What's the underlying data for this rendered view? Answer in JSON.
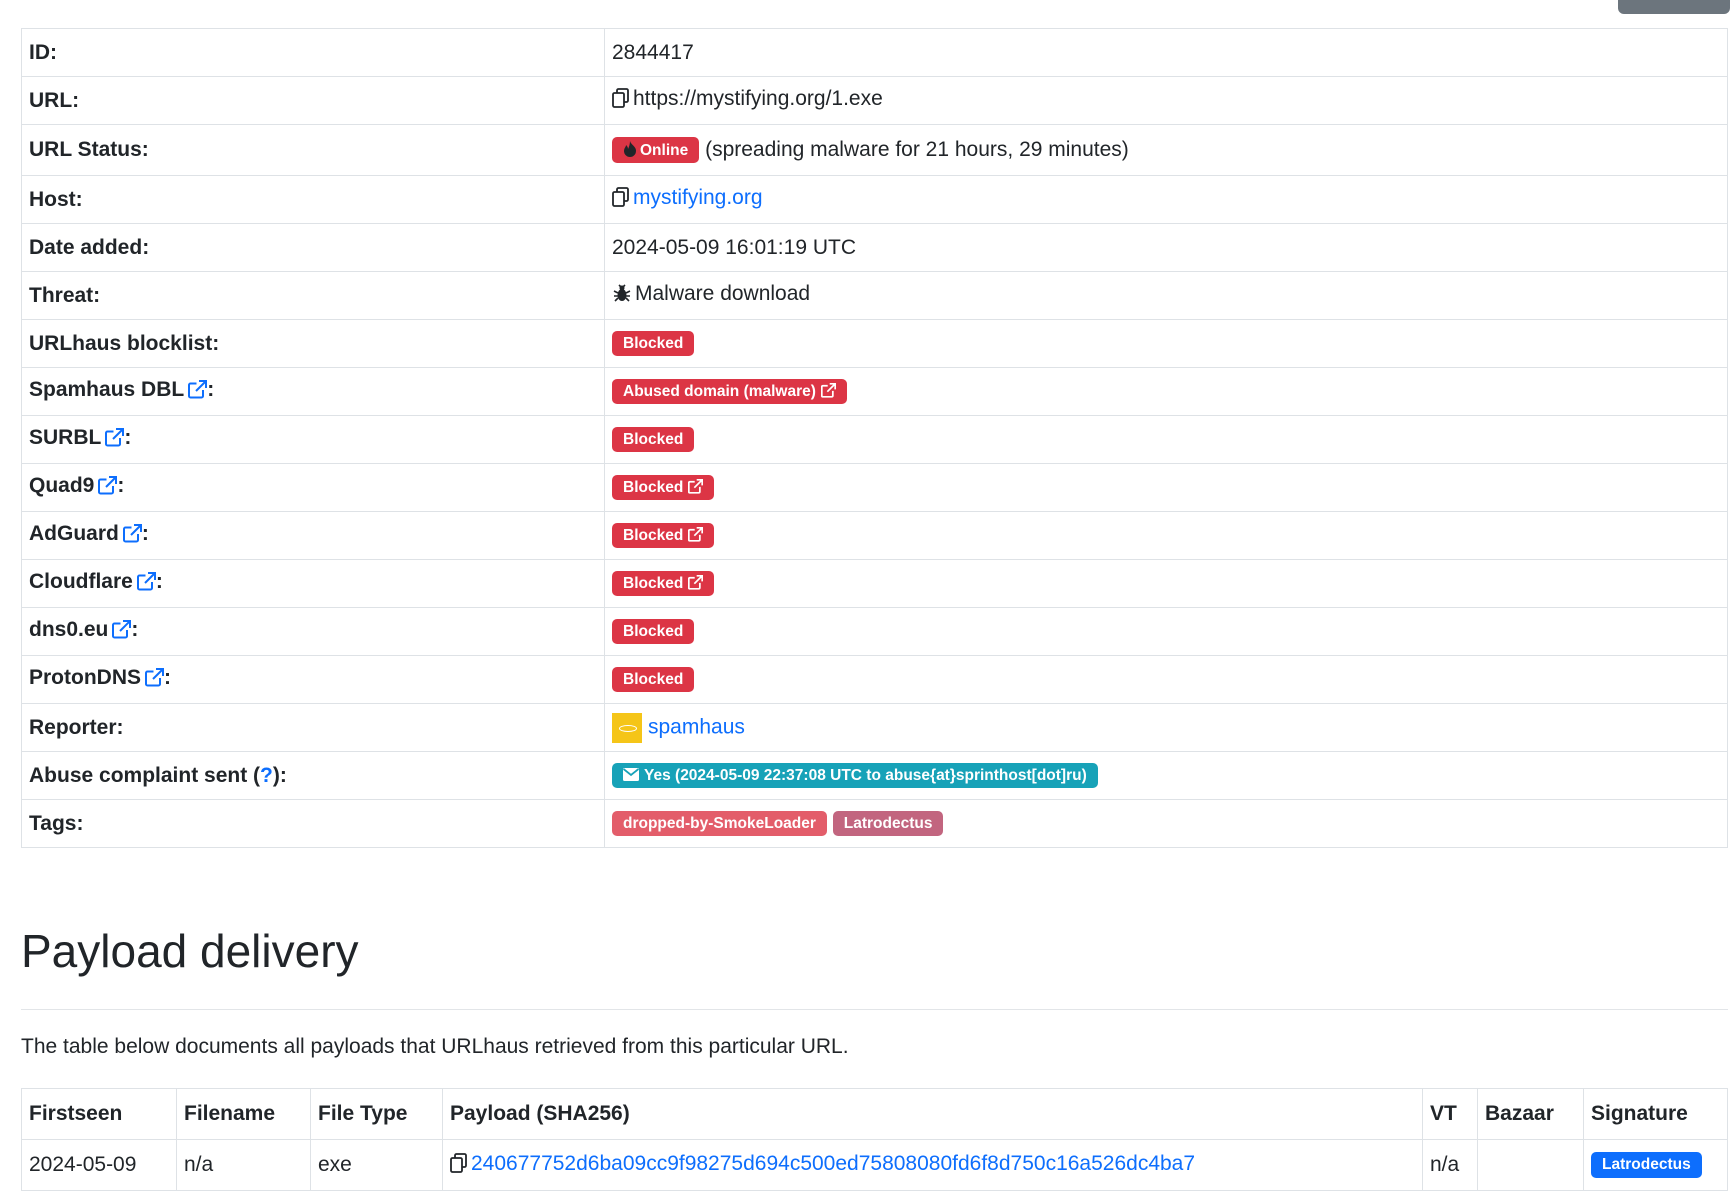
{
  "info": {
    "id": {
      "label": "ID:",
      "value": "2844417"
    },
    "url": {
      "label": "URL:",
      "value": "https://mystifying.org/1.exe"
    },
    "status": {
      "label": "URL Status:",
      "badge": "Online",
      "text": "(spreading malware for 21 hours, 29 minutes)"
    },
    "host": {
      "label": "Host:",
      "value": "mystifying.org"
    },
    "date_added": {
      "label": "Date added:",
      "value": "2024-05-09 16:01:19 UTC"
    },
    "threat": {
      "label": "Threat:",
      "value": "Malware download"
    },
    "blocklist": {
      "label": "URLhaus blocklist:",
      "badge": "Blocked"
    },
    "spamhaus": {
      "label": "Spamhaus DBL",
      "badge": "Abused domain (malware)"
    },
    "surbl": {
      "label": "SURBL",
      "badge": "Blocked"
    },
    "quad9": {
      "label": "Quad9",
      "badge": "Blocked"
    },
    "adguard": {
      "label": "AdGuard",
      "badge": "Blocked"
    },
    "cloudflare": {
      "label": "Cloudflare",
      "badge": "Blocked"
    },
    "dns0": {
      "label": "dns0.eu",
      "badge": "Blocked"
    },
    "protondns": {
      "label": "ProtonDNS",
      "badge": "Blocked"
    },
    "reporter": {
      "label": "Reporter:",
      "value": "spamhaus"
    },
    "abuse": {
      "label_pre": "Abuse complaint sent (",
      "help": "?",
      "label_post": "):",
      "badge": "Yes (2024-05-09 22:37:08 UTC to abuse{at}sprinthost[dot]ru)"
    },
    "tags": {
      "label": "Tags:",
      "items": [
        "dropped-by-SmokeLoader",
        "Latrodectus"
      ]
    }
  },
  "colon": ":",
  "payload": {
    "heading": "Payload delivery",
    "intro": "The table below documents all payloads that URLhaus retrieved from this particular URL.",
    "columns": [
      "Firstseen",
      "Filename",
      "File Type",
      "Payload (SHA256)",
      "VT",
      "Bazaar",
      "Signature"
    ],
    "rows": [
      {
        "firstseen": "2024-05-09",
        "filename": "n/a",
        "filetype": "exe",
        "sha256": "240677752d6ba09cc9f98275d694c500ed75808080fd6f8d750c16a526dc4ba7",
        "vt": "n/a",
        "bazaar": "",
        "signature": "Latrodectus"
      }
    ]
  },
  "colors": {
    "danger": "#dc3545",
    "info": "#17a2b8",
    "link": "#0d6efd",
    "tag1": "#e35d6a",
    "tag2": "#c2657f",
    "logo": "#f5c518"
  }
}
